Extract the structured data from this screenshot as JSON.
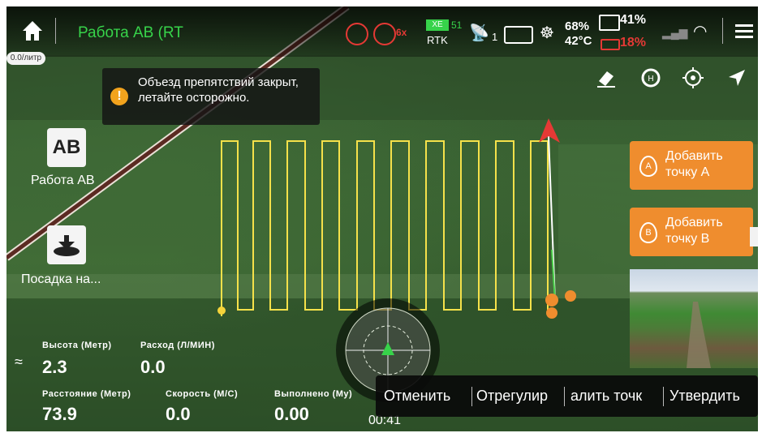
{
  "topbar": {
    "title": "Работа АВ (RT",
    "home_icon": "home-icon",
    "sat_label": "XE",
    "sat_count": "51",
    "rtk_label": "RTK",
    "signal_count": "1",
    "battery_pct": "68%",
    "temperature": "42°C",
    "rc_battery": "41%",
    "drone_battery": "18%",
    "warn_badge": "6x",
    "menu_icon": "menu-icon"
  },
  "flow_rate_chip": "0.0/литр",
  "notice": {
    "text": "Объезд препятствий закрыт, летайте осторожно."
  },
  "left_panel": {
    "ab_icon_text": "AB",
    "ab_label": "Работа АВ",
    "landing_label": "Посадка на..."
  },
  "right_panel": {
    "point_a_badge": "A",
    "point_a_line1": "Добавить",
    "point_a_line2": "точку A",
    "point_b_badge": "B",
    "point_b_line1": "Добавить",
    "point_b_line2": "точку B"
  },
  "stats": {
    "height_label": "Высота (Метр)",
    "height_value": "2.3",
    "flow_label": "Расход (Л/МИН)",
    "flow_value": "0.0",
    "distance_label": "Расстояние (Метр)",
    "distance_value": "73.9",
    "speed_label": "Скорость (М/С)",
    "speed_value": "0.0",
    "done_label": "Выполнено (Му)",
    "done_value": "0.00",
    "timer": "00:41"
  },
  "actions": {
    "cancel": "Отменить",
    "adjust": "Отрегулир",
    "delete": "алить точк",
    "confirm": "Утвердить"
  },
  "colors": {
    "accent_orange": "#ef8d2e",
    "route_yellow": "#f5e14a",
    "title_green": "#37d34a",
    "warn_red": "#e53935"
  }
}
